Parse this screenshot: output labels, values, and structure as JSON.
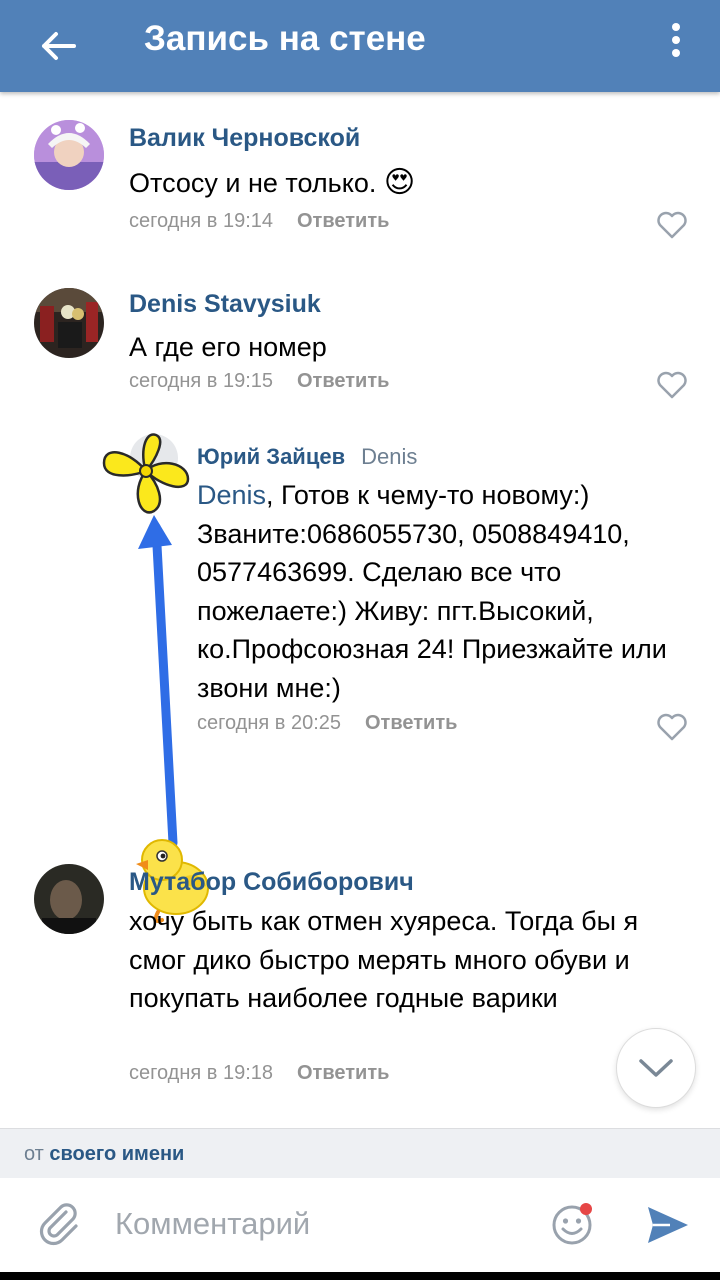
{
  "header": {
    "title": "Запись на стене",
    "back_icon": "arrow-left-icon",
    "more_icon": "more-vertical-icon"
  },
  "comments": [
    {
      "author": "Валик Черновской",
      "text": "Отсосу и не только.",
      "emoji": "😍",
      "time": "сегодня в 19:14",
      "reply_label": "Ответить"
    },
    {
      "author": "Denis Stavysiuk",
      "text": "А где его номер",
      "time": "сегодня в 19:15",
      "reply_label": "Ответить"
    },
    {
      "author": "Юрий Зайцев",
      "reply_to": "Denis",
      "mention": "Denis",
      "text": ", Готов к чему-то новому:) Званите:0686055730, 0508849410, 0577463699. Сделаю все что пожелаете:) Живу: пгт.Высокий, ко.Профсоюзная 24! Приезжайте или  звони мне:)",
      "time": "сегодня в 20:25",
      "reply_label": "Ответить"
    },
    {
      "author": "Мутабор Собиборович",
      "text": "хочу быть как отмен хуяреса. Тогда бы я смог дико быстро мерять много обуви и покупать наиболее годные варики",
      "time": "сегодня в 19:18",
      "reply_label": "Ответить"
    }
  ],
  "composer": {
    "from_prefix": "от",
    "from_name": "своего имени",
    "placeholder": "Комментарий"
  },
  "colors": {
    "header": "#5181b8",
    "link": "#2a5885",
    "muted": "#939393",
    "send": "#5181b8"
  }
}
